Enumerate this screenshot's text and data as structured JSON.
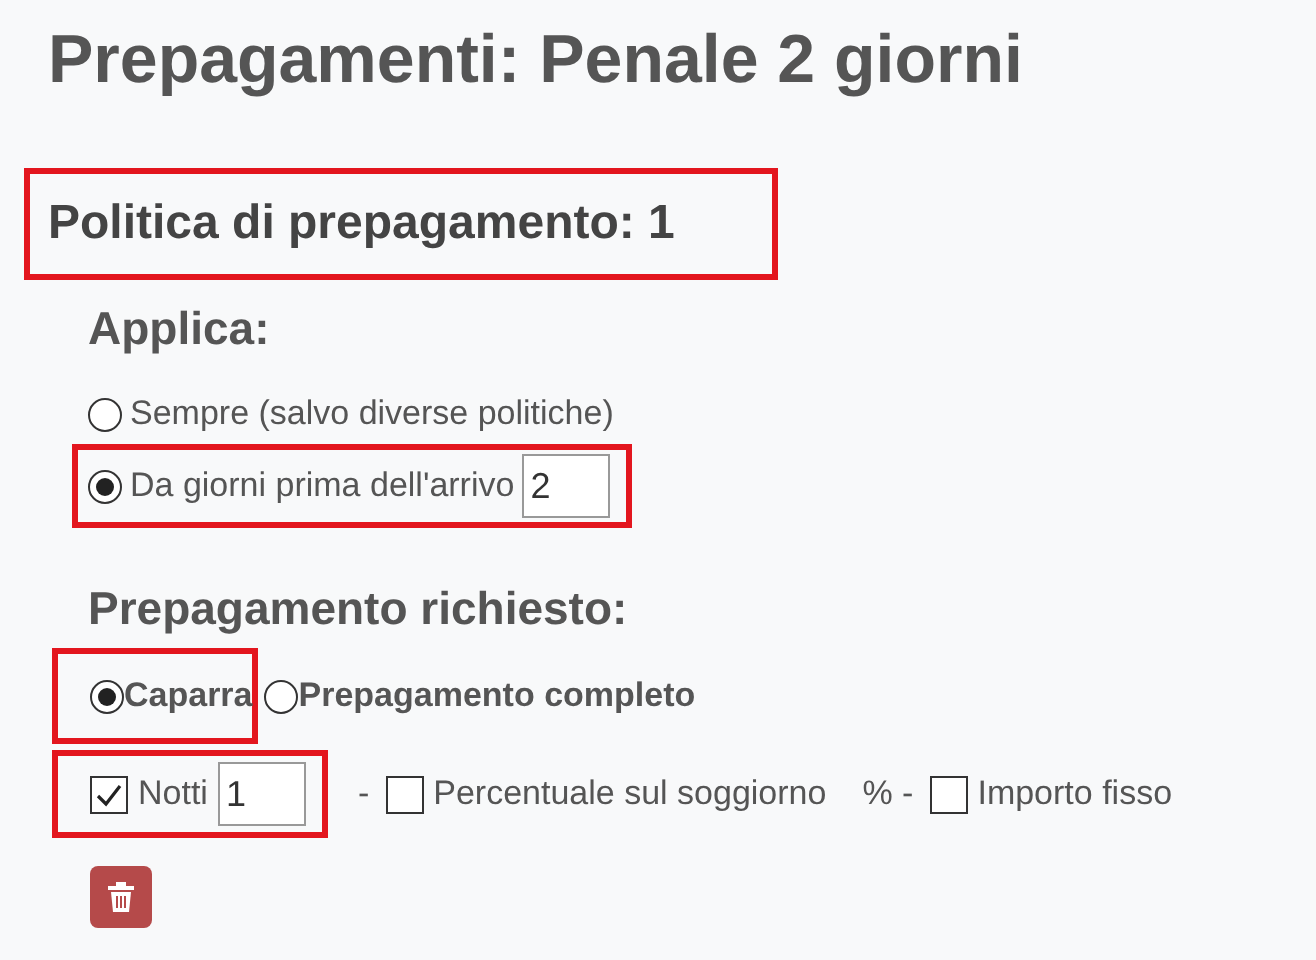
{
  "title": "Prepagamenti: Penale 2 giorni",
  "policy": {
    "heading": "Politica di prepagamento: 1",
    "highlighted": true
  },
  "apply": {
    "heading": "Applica:",
    "options": [
      {
        "label": "Sempre (salvo diverse politiche)",
        "selected": false,
        "highlighted": false
      },
      {
        "label": "Da giorni prima dell'arrivo",
        "selected": true,
        "value": "2",
        "highlighted": true
      }
    ]
  },
  "required": {
    "heading": "Prepagamento richiesto:",
    "options": [
      {
        "label": "Caparra",
        "selected": true,
        "highlighted": true
      },
      {
        "label": "Prepagamento completo",
        "selected": false,
        "highlighted": false
      }
    ],
    "items": [
      {
        "kind": "check",
        "checked": true,
        "label": "Notti",
        "value": "1",
        "highlighted": true
      },
      {
        "kind": "text",
        "label": "-"
      },
      {
        "kind": "check",
        "checked": false,
        "label": "Percentuale sul soggiorno",
        "highlighted": false
      },
      {
        "kind": "text",
        "label": "% -"
      },
      {
        "kind": "check",
        "checked": false,
        "label": "Importo fisso",
        "highlighted": false
      }
    ]
  }
}
